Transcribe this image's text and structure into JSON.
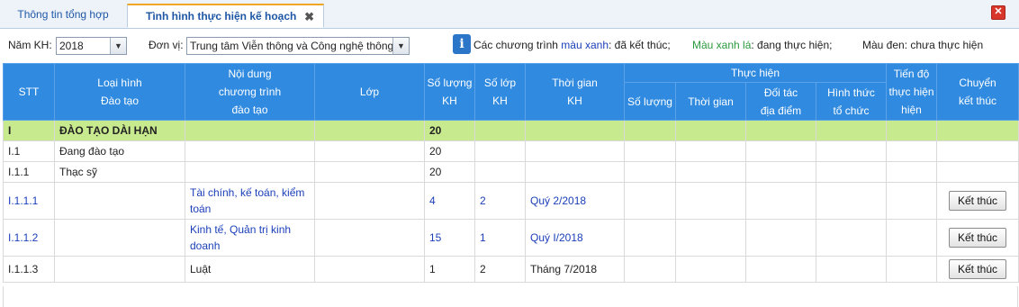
{
  "tabs": [
    {
      "label": "Thông tin tổng hợp"
    },
    {
      "label": "Tình hình thực hiện kế hoạch"
    }
  ],
  "tab_close_icon": "✖",
  "window_close_icon": "✕",
  "filters": {
    "year_label": "Năm KH:",
    "year_value": "2018",
    "unit_label": "Đơn vị:",
    "unit_value": "Trung tâm Viễn thông và Công nghệ thông tin"
  },
  "legend": {
    "info_icon": "i",
    "part1": "Các chương trình",
    "part1_blue": "màu xanh",
    "part1_end": ": đã kết thúc;",
    "part2_green": "Màu xanh lá",
    "part2_end": ": đang thực hiện;",
    "part3": "Màu đen: chưa thực hiện"
  },
  "colors": {
    "header": "#2f8ae0",
    "highlight_row": "#c8ea8f",
    "done": "#1a3fb8",
    "in_progress": "#2b9a3e"
  },
  "table": {
    "headers": {
      "stt": "STT",
      "loai_hinh": [
        "Loại hình",
        "Đào tạo"
      ],
      "noi_dung": [
        "Nội dung",
        "chương trình",
        "đào tạo"
      ],
      "lop": "Lớp",
      "so_luong_kh": [
        "Số lượng",
        "KH"
      ],
      "so_lop_kh": [
        "Số lớp",
        "KH"
      ],
      "thoi_gian_kh": [
        "Thời gian",
        "KH"
      ],
      "thuc_hien": "Thực hiện",
      "th_so_luong": "Số lượng",
      "th_thoi_gian": "Thời gian",
      "th_doi_tac": [
        "Đối tác",
        "địa điểm"
      ],
      "th_hinh_thuc": [
        "Hình thức",
        "tổ chức"
      ],
      "tien_do": [
        "Tiến độ",
        "thực hiện",
        "hiện"
      ],
      "chuyen": [
        "Chuyển",
        "kết thúc"
      ]
    },
    "rows": [
      {
        "stt": "I",
        "loai": "ĐÀO TẠO DÀI HẠN",
        "noi_dung": "",
        "so_luong": "20",
        "so_lop": "",
        "thoi_gian": "",
        "button": ""
      },
      {
        "stt": "I.1",
        "loai": "Đang đào tạo",
        "noi_dung": "",
        "so_luong": "20",
        "so_lop": "",
        "thoi_gian": "",
        "button": ""
      },
      {
        "stt": "I.1.1",
        "loai": "Thạc sỹ",
        "noi_dung": "",
        "so_luong": "20",
        "so_lop": "",
        "thoi_gian": "",
        "button": ""
      },
      {
        "stt": "I.1.1.1",
        "loai": "",
        "noi_dung": "Tài chính, kế toán, kiểm toán",
        "so_luong": "4",
        "so_lop": "2",
        "thoi_gian": "Quý 2/2018",
        "button": "Kết thúc"
      },
      {
        "stt": "I.1.1.2",
        "loai": "",
        "noi_dung": "Kinh tế, Quản trị kinh doanh",
        "so_luong": "15",
        "so_lop": "1",
        "thoi_gian": "Quý I/2018",
        "button": "Kết thúc"
      },
      {
        "stt": "I.1.1.3",
        "loai": "",
        "noi_dung": "Luật",
        "so_luong": "1",
        "so_lop": "2",
        "thoi_gian": "Tháng 7/2018",
        "button": "Kết thúc"
      }
    ]
  }
}
